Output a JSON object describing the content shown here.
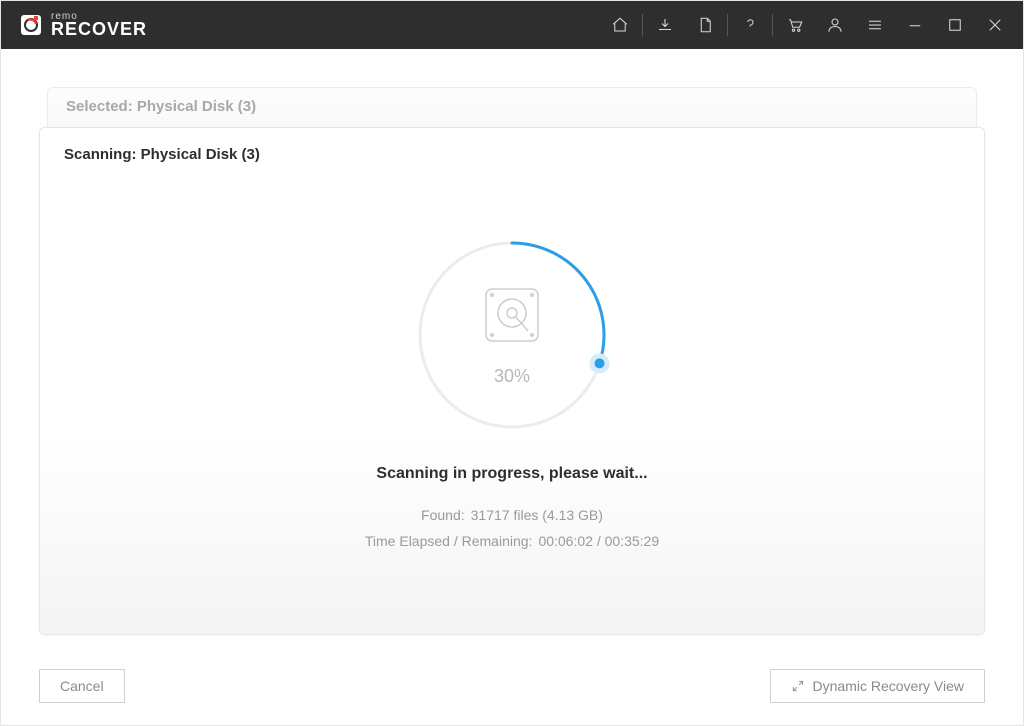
{
  "app": {
    "brand_small": "remo",
    "brand_main": "RECOVER"
  },
  "card": {
    "back_title": "Selected: Physical Disk (3)",
    "front_title": "Scanning: Physical Disk (3)"
  },
  "progress": {
    "percent_label": "30%",
    "percent_value": 30,
    "status_title": "Scanning in progress, please wait...",
    "found_label": "Found:",
    "found_value": "31717 files (4.13 GB)",
    "time_label": "Time Elapsed / Remaining:",
    "time_value": "00:06:02 / 00:35:29"
  },
  "footer": {
    "cancel": "Cancel",
    "dynamic": "Dynamic Recovery View"
  }
}
